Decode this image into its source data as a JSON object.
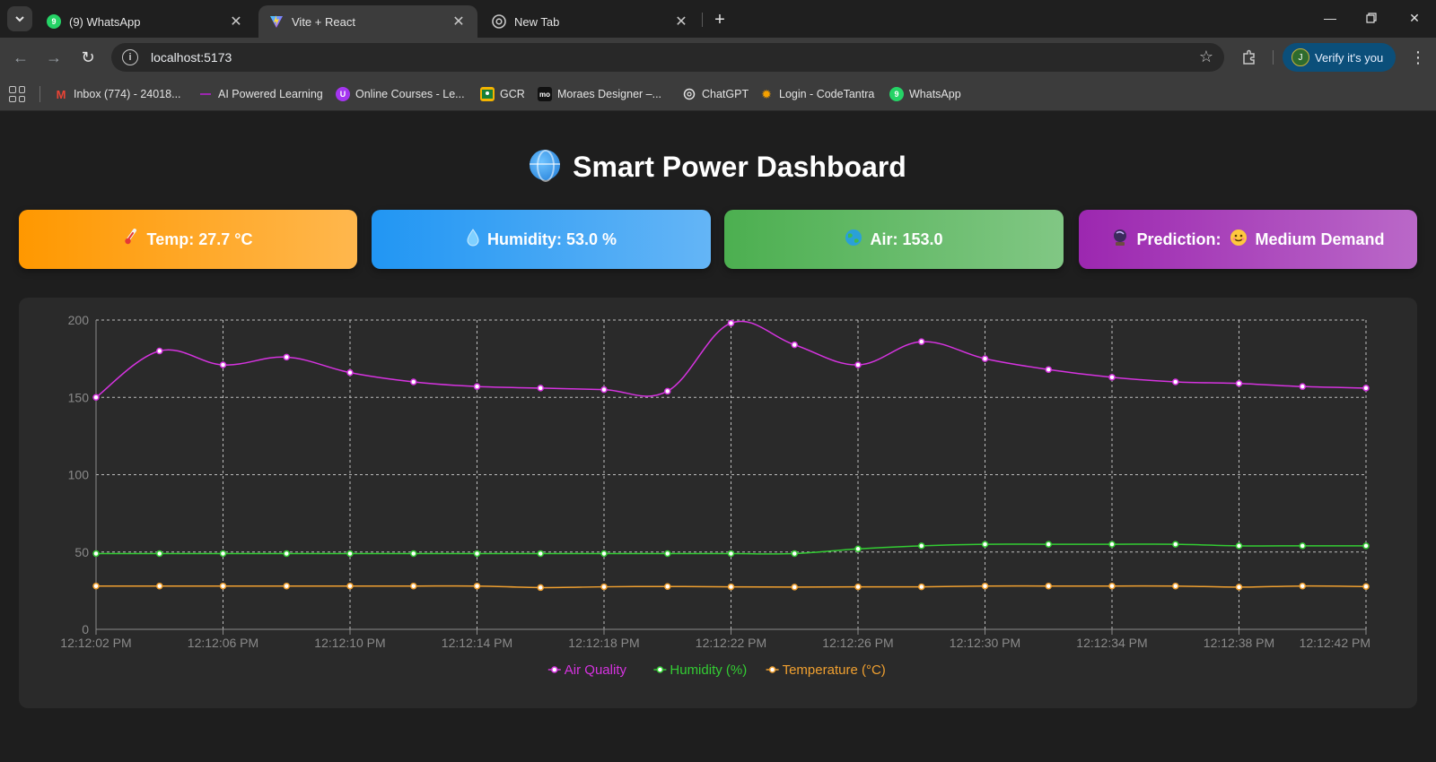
{
  "browser": {
    "tabs": [
      {
        "title": "(9) WhatsApp",
        "favicon": "whatsapp-icon",
        "badge": "9",
        "active": false
      },
      {
        "title": "Vite + React",
        "favicon": "vite-icon",
        "active": true
      },
      {
        "title": "New Tab",
        "favicon": "chrome-icon",
        "active": false
      }
    ],
    "url": "localhost:5173",
    "verify_label": "Verify it's you",
    "avatar_letter": "J",
    "bookmarks": [
      {
        "label": "Inbox (774) - 24018...",
        "icon": "gmail-icon"
      },
      {
        "label": "AI Powered Learning",
        "icon": "ai-learning-icon"
      },
      {
        "label": "Online Courses - Le...",
        "icon": "udemy-icon"
      },
      {
        "label": "GCR",
        "icon": "classroom-icon"
      },
      {
        "label": "Moraes Designer –...",
        "icon": "moraes-icon"
      },
      {
        "label": "ChatGPT",
        "icon": "chatgpt-icon"
      },
      {
        "label": "Login - CodeTantra",
        "icon": "codetantra-icon"
      },
      {
        "label": "WhatsApp",
        "icon": "whatsapp-icon"
      }
    ]
  },
  "dashboard": {
    "title": "Smart Power Dashboard",
    "title_icon": "globe-icon",
    "cards": {
      "temp": {
        "text": "Temp: 27.7 °C",
        "icon": "thermometer-icon",
        "color": "#ff9800"
      },
      "humidity": {
        "text": "Humidity: 53.0 %",
        "icon": "droplet-icon",
        "color": "#2196f3"
      },
      "air": {
        "text": "Air: 153.0",
        "icon": "earth-icon",
        "color": "#4caf50"
      },
      "prediction": {
        "label": "Prediction:",
        "value": "Medium Demand",
        "icon": "crystal-ball-icon",
        "value_icon": "smiley-icon",
        "color": "#9c27b0"
      }
    }
  },
  "chart_data": {
    "type": "line",
    "title": "",
    "xlabel": "",
    "ylabel": "",
    "ylim": [
      0,
      200
    ],
    "yticks": [
      0,
      50,
      100,
      150,
      200
    ],
    "grid": true,
    "legend_position": "bottom",
    "x": [
      "12:12:02 PM",
      "12:12:04 PM",
      "12:12:06 PM",
      "12:12:08 PM",
      "12:12:10 PM",
      "12:12:12 PM",
      "12:12:14 PM",
      "12:12:16 PM",
      "12:12:18 PM",
      "12:12:20 PM",
      "12:12:22 PM",
      "12:12:24 PM",
      "12:12:26 PM",
      "12:12:28 PM",
      "12:12:30 PM",
      "12:12:32 PM",
      "12:12:34 PM",
      "12:12:36 PM",
      "12:12:38 PM",
      "12:12:40 PM",
      "12:12:42 PM"
    ],
    "xtick_labels": [
      "12:12:02 PM",
      "12:12:06 PM",
      "12:12:10 PM",
      "12:12:14 PM",
      "12:12:18 PM",
      "12:12:22 PM",
      "12:12:26 PM",
      "12:12:30 PM",
      "12:12:34 PM",
      "12:12:38 PM",
      "12:12:42 PM"
    ],
    "series": [
      {
        "name": "Air Quality",
        "color": "#d633e0",
        "values": [
          150,
          180,
          171,
          176,
          166,
          160,
          157,
          156,
          155,
          154,
          198,
          184,
          171,
          186,
          175,
          168,
          163,
          160,
          159,
          157,
          156
        ]
      },
      {
        "name": "Humidity (%)",
        "color": "#33cc33",
        "values": [
          49,
          49,
          49,
          49,
          49,
          49,
          49,
          49,
          49,
          49,
          49,
          49,
          52,
          54,
          55,
          55,
          55,
          55,
          54,
          54,
          54
        ]
      },
      {
        "name": "Temperature (°C)",
        "color": "#f0a030",
        "values": [
          28,
          28,
          28,
          28,
          28,
          28,
          28,
          27,
          27.5,
          27.7,
          27.5,
          27.3,
          27.5,
          27.5,
          28,
          28,
          28,
          28,
          27.3,
          28,
          27.7
        ]
      }
    ]
  }
}
